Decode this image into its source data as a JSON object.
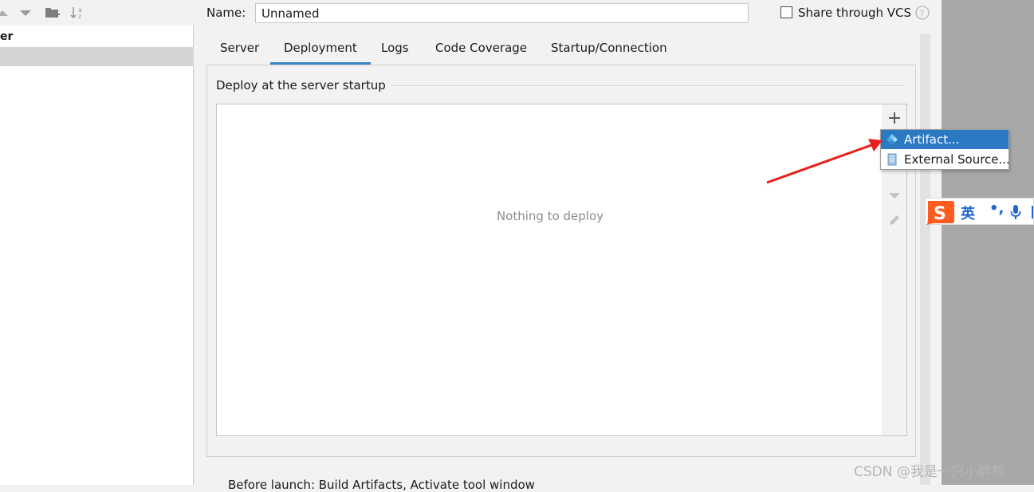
{
  "tree": {
    "item_label": "er"
  },
  "name_row": {
    "label": "Name:",
    "value": "Unnamed",
    "share_label": "Share through VCS",
    "share_checked": false
  },
  "tabs": [
    {
      "label": "Server"
    },
    {
      "label": "Deployment",
      "active": true
    },
    {
      "label": "Logs"
    },
    {
      "label": "Code Coverage"
    },
    {
      "label": "Startup/Connection"
    }
  ],
  "deploy": {
    "section_title": "Deploy at the server startup",
    "empty_text": "Nothing to deploy"
  },
  "popup_menu": [
    {
      "label": "Artifact...",
      "icon": "artifact-icon",
      "selected": true
    },
    {
      "label": "External Source...",
      "icon": "external-source-icon",
      "selected": false
    }
  ],
  "ime": {
    "lang": "英",
    "punct": "•,"
  },
  "bottom": {
    "partial_text": "Before launch: Build Artifacts, Activate tool window"
  },
  "watermark": "CSDN @我是一只小胖熊",
  "colors": {
    "accent": "#3d86c6",
    "selection": "#2b79c2",
    "annotation_arrow": "#e8201c",
    "ime_brand": "#ff5a1f"
  }
}
